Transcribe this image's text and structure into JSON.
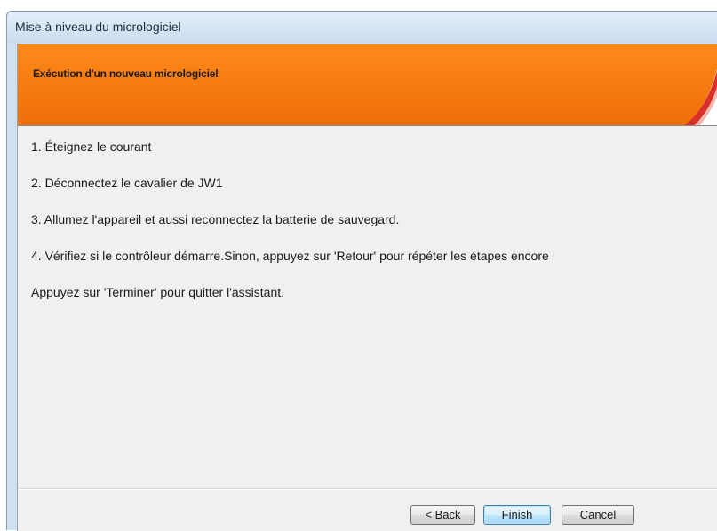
{
  "window": {
    "title": "Mise à niveau du micrologiciel"
  },
  "banner": {
    "title": "Exécution d'un nouveau micrologiciel",
    "accent_color": "#f47a10",
    "swoosh_color": "#d9302a"
  },
  "steps": [
    "1. Éteignez le courant",
    "2. Déconnectez le cavalier de JW1",
    "3. Allumez l'appareil et aussi reconnectez la batterie de sauvegard.",
    "4. Vérifiez si le contrôleur démarre.Sinon, appuyez sur 'Retour' pour répéter les étapes encore",
    "Appuyez sur 'Terminer' pour quitter l'assistant."
  ],
  "buttons": {
    "back": "< Back",
    "finish": "Finish",
    "cancel": "Cancel"
  }
}
